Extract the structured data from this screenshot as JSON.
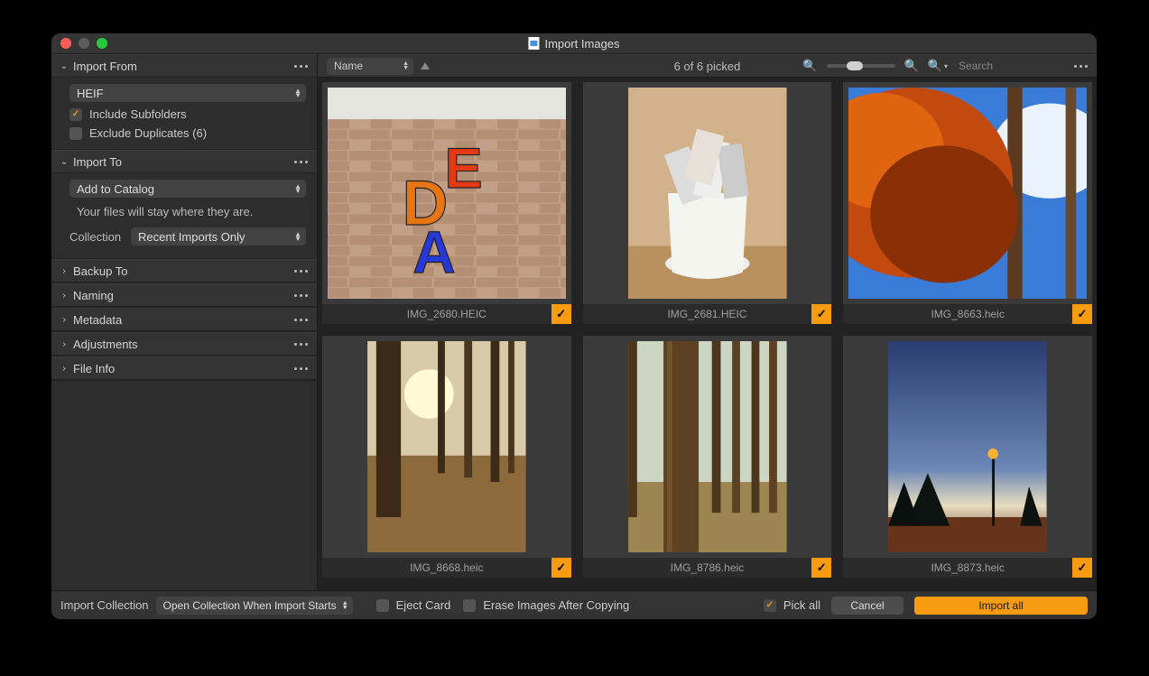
{
  "window": {
    "title": "Import Images"
  },
  "sidebar": {
    "import_from": {
      "title": "Import From",
      "expanded": true,
      "source": "HEIF",
      "include_subfolders": {
        "label": "Include Subfolders",
        "checked": true
      },
      "exclude_duplicates": {
        "label": "Exclude Duplicates (6)",
        "checked": false
      }
    },
    "import_to": {
      "title": "Import To",
      "expanded": true,
      "dest": "Add to Catalog",
      "info": "Your files will stay where they are.",
      "collection_label": "Collection",
      "collection_value": "Recent Imports Only"
    },
    "backup_to": {
      "title": "Backup To"
    },
    "naming": {
      "title": "Naming"
    },
    "metadata": {
      "title": "Metadata"
    },
    "adjustments": {
      "title": "Adjustments"
    },
    "file_info": {
      "title": "File Info"
    }
  },
  "toolbar": {
    "sort_by": "Name",
    "picked_text": "6 of 6 picked",
    "search_placeholder": "Search"
  },
  "thumbs": [
    {
      "filename": "IMG_2680.HEIC",
      "picked": true
    },
    {
      "filename": "IMG_2681.HEIC",
      "picked": true
    },
    {
      "filename": "IMG_8663.heic",
      "picked": true
    },
    {
      "filename": "IMG_8668.heic",
      "picked": true
    },
    {
      "filename": "IMG_8786.heic",
      "picked": true
    },
    {
      "filename": "IMG_8873.heic",
      "picked": true
    }
  ],
  "footer": {
    "import_collection_label": "Import Collection",
    "import_collection_value": "Open Collection When Import Starts",
    "eject_card": {
      "label": "Eject Card",
      "checked": false
    },
    "erase_after": {
      "label": "Erase Images After Copying",
      "checked": false
    },
    "pick_all": {
      "label": "Pick all",
      "checked": true
    },
    "cancel": "Cancel",
    "import_all": "Import all"
  }
}
